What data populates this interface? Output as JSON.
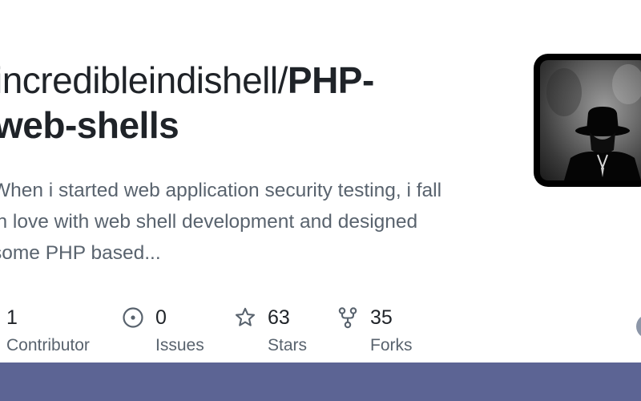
{
  "repo": {
    "owner": "incredibleindishell/",
    "name_line1": "PHP-",
    "name_line2": "web-shells"
  },
  "description": {
    "line1": "When i started web application security testing, i fall",
    "line2": "in love with web shell development and designed",
    "line3": "some PHP based..."
  },
  "stats": [
    {
      "icon": "people-icon",
      "value": "1",
      "label": "Contributor"
    },
    {
      "icon": "issue-icon",
      "value": "0",
      "label": "Issues"
    },
    {
      "icon": "star-icon",
      "value": "63",
      "label": "Stars"
    },
    {
      "icon": "fork-icon",
      "value": "35",
      "label": "Forks"
    }
  ],
  "colors": {
    "text": "#1f2328",
    "muted": "#59636e",
    "bottom_bar": "#5c6494"
  }
}
